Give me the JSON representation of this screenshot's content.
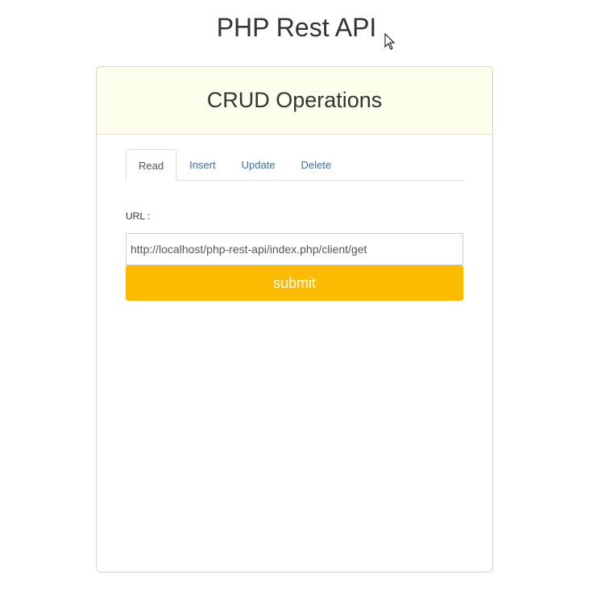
{
  "page": {
    "title": "PHP Rest API"
  },
  "panel": {
    "heading": "CRUD Operations"
  },
  "tabs": [
    {
      "label": "Read",
      "active": true
    },
    {
      "label": "Insert",
      "active": false
    },
    {
      "label": "Update",
      "active": false
    },
    {
      "label": "Delete",
      "active": false
    }
  ],
  "form": {
    "url_label": "URL :",
    "url_value": "http://localhost/php-rest-api/index.php/client/get",
    "submit_label": "submit"
  },
  "colors": {
    "accent": "#fbbb00",
    "heading_bg": "#fefeec",
    "link": "#3a6fa8"
  },
  "icons": {
    "cursor": "mouse-pointer-icon"
  }
}
